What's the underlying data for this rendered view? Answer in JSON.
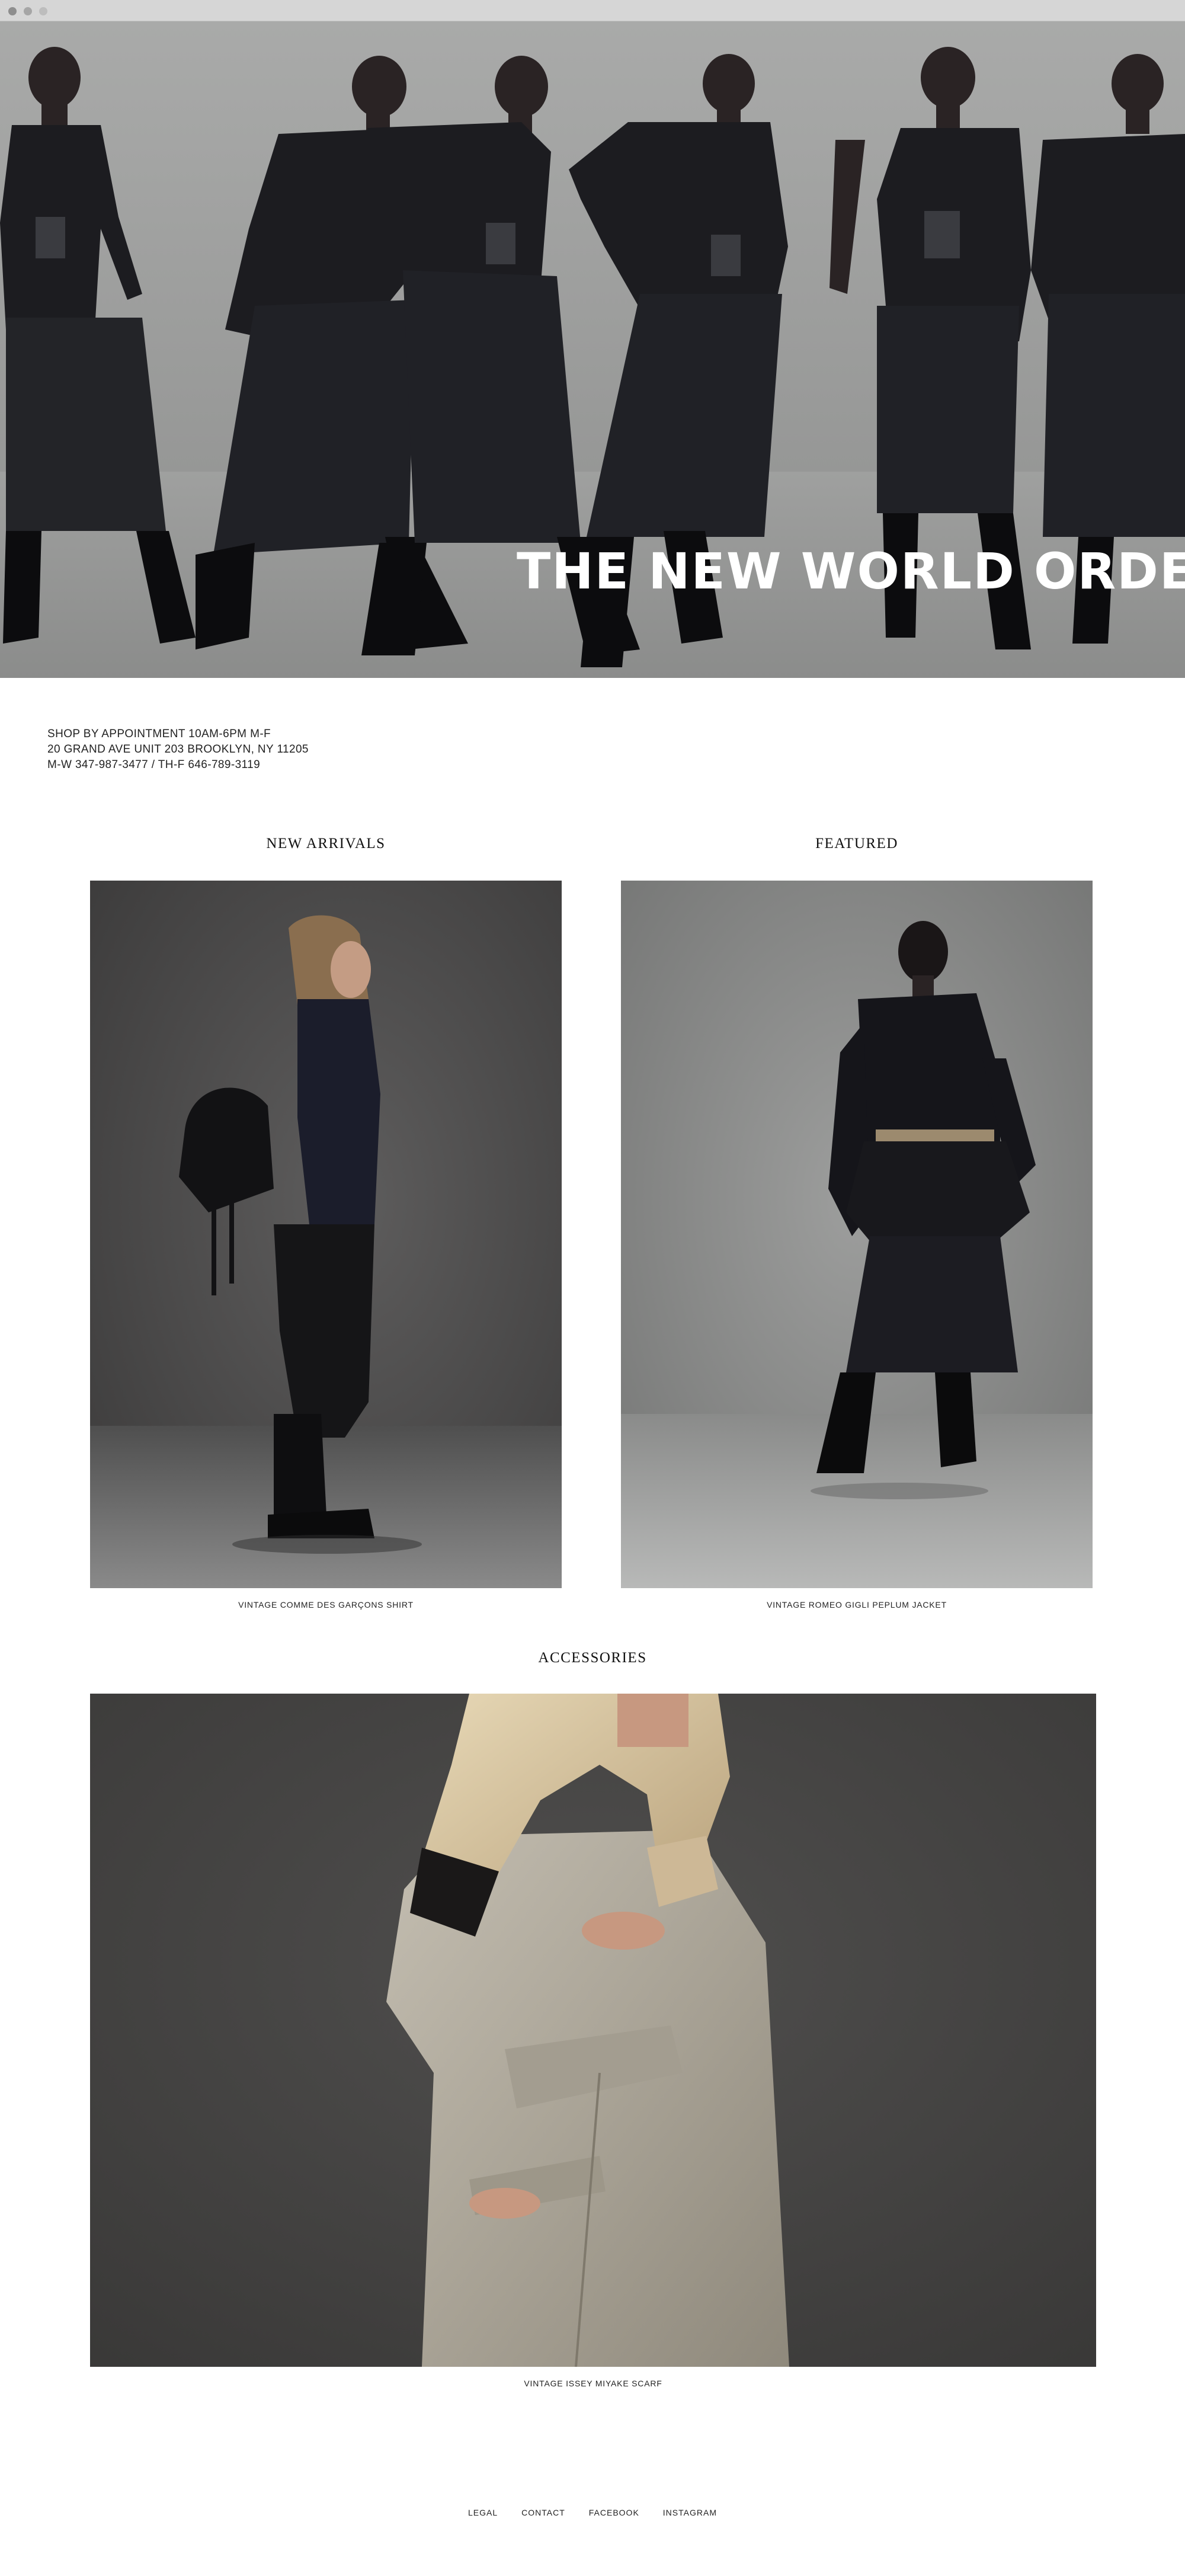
{
  "hero": {
    "title": "THE NEW WORLD ORDER"
  },
  "store_info": {
    "line1": "SHOP BY APPOINTMENT 10AM-6PM M-F",
    "line2": "20 GRAND AVE UNIT 203 BROOKLYN, NY 11205",
    "line3": "M-W 347-987-3477 / TH-F 646-789-3119"
  },
  "sections": {
    "new_arrivals": {
      "heading": "NEW ARRIVALS",
      "caption": "VINTAGE COMME DES GARÇONS SHIRT"
    },
    "featured": {
      "heading": "FEATURED",
      "caption": "VINTAGE ROMEO GIGLI PEPLUM JACKET"
    },
    "accessories": {
      "heading": "ACCESSORIES",
      "caption": "VINTAGE ISSEY MIYAKE SCARF"
    }
  },
  "footer": {
    "links": [
      "LEGAL",
      "CONTACT",
      "FACEBOOK",
      "INSTAGRAM"
    ]
  },
  "colors": {
    "chrome": "#d6d6d6",
    "hero_backdrop": "#a9aaa9",
    "studio_dark": "#4a4949",
    "studio_light": "#9c9d9c",
    "garment_black": "#1b1b1f",
    "coat_stone": "#b7b1a4",
    "scarf_cream": "#d8c39c"
  }
}
